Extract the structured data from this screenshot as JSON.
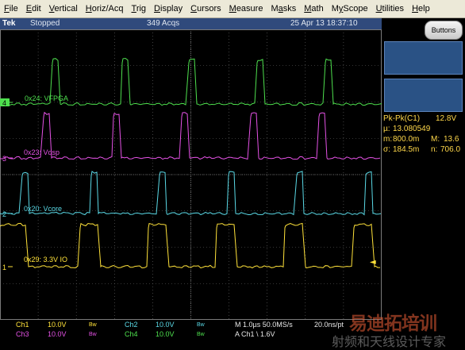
{
  "menu": {
    "items": [
      {
        "label": "File",
        "u": "F",
        "rest": "ile"
      },
      {
        "label": "Edit",
        "u": "E",
        "rest": "dit"
      },
      {
        "label": "Vertical",
        "u": "V",
        "rest": "ertical"
      },
      {
        "label": "Horiz/Acq",
        "u": "H",
        "rest": "oriz/Acq"
      },
      {
        "label": "Trig",
        "u": "T",
        "rest": "rig"
      },
      {
        "label": "Display",
        "u": "D",
        "rest": "isplay"
      },
      {
        "label": "Cursors",
        "u": "C",
        "rest": "ursors"
      },
      {
        "label": "Measure",
        "u": "M",
        "rest": "easure"
      },
      {
        "label": "Masks",
        "u": "a",
        "pre": "M",
        "rest": "sks"
      },
      {
        "label": "Math",
        "u": "M",
        "rest": "ath"
      },
      {
        "label": "MyScope",
        "u": "y",
        "pre": "M",
        "rest": "Scope"
      },
      {
        "label": "Utilities",
        "u": "U",
        "rest": "tilities"
      },
      {
        "label": "Help",
        "u": "H",
        "rest": "elp"
      }
    ]
  },
  "status": {
    "brand": "Tek",
    "state": "Stopped",
    "acqs": "349 Acqs",
    "datetime": "25 Apr 13 18:37:10"
  },
  "right_panel": {
    "buttons_label": "Buttons",
    "measurement": {
      "name": "Pk-Pk(C1)",
      "value": "12.8V",
      "mu_label": "µ:",
      "mu": "13.080549",
      "m_label": "m:",
      "m": "800.0m",
      "M_label": "M:",
      "M": "13.6",
      "sigma_label": "σ:",
      "sigma": "184.5m",
      "n_label": "n:",
      "n": "706.0"
    }
  },
  "channels": [
    {
      "id": 4,
      "marker": "4",
      "label": "0x24: VFPGA",
      "color": "#4ee04e"
    },
    {
      "id": 3,
      "marker": "3",
      "label": "0x23: Vdsp",
      "color": "#e552e6"
    },
    {
      "id": 2,
      "marker": "2",
      "label": "0x20: Vcore",
      "color": "#5ad9e6"
    },
    {
      "id": 1,
      "marker": "1",
      "label": "0x29: 3.3V IO",
      "color": "#ffe23a"
    }
  ],
  "trigger_marker": "◄",
  "readout": {
    "ch1": "Ch1",
    "ch1_scale": "10.0V",
    "ch1_bw": "Bw",
    "ch2": "Ch2",
    "ch2_scale": "10.0V",
    "ch2_bw": "Bw",
    "ch3": "Ch3",
    "ch3_scale": "10.0V",
    "ch3_bw": "Bw",
    "ch4": "Ch4",
    "ch4_scale": "10.0V",
    "ch4_bw": "Bw",
    "timebase": "M 1.0µs 50.0MS/s",
    "resolution": "20.0ns/pt",
    "trigger": "A  Ch1  \\  1.6V"
  },
  "watermark": {
    "line1": "易迪拓培训",
    "line2": "射频和天线设计专家"
  },
  "colors": {
    "ch1": "#ffe23a",
    "ch2": "#5ad9e6",
    "ch3": "#e552e6",
    "ch4": "#4ee04e",
    "menubar": "#ece9d8",
    "statusbar": "#304a7c",
    "graticule": "#6a6a6a"
  }
}
